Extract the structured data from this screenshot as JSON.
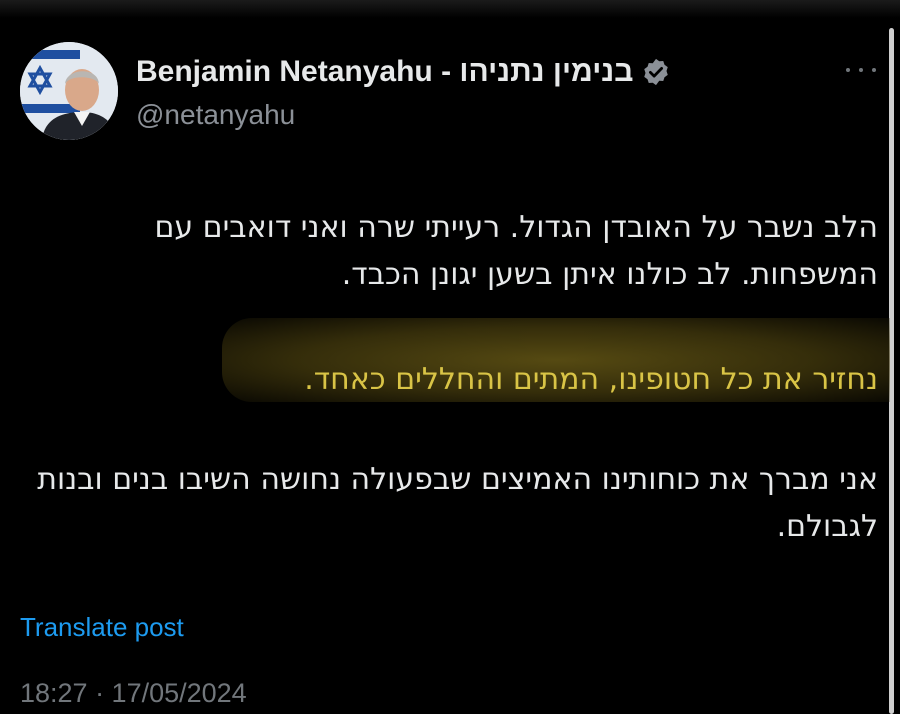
{
  "author": {
    "name": "Benjamin Netanyahu - בנימין נתניהו",
    "handle": "@netanyahu",
    "verified_icon": "verified-badge-icon",
    "verified_color": "#8b9097"
  },
  "post": {
    "paragraph1": "הלב נשבר על האובדן הגדול. רעייתי שרה ואני דואבים עם המשפחות. לב כולנו איתן בשען יגונן הכבד.",
    "paragraph2_highlighted": "נחזיר את כל חטופינו, המתים והחללים כאחד.",
    "paragraph3": "אני מברך את כוחותינו האמיצים שבפעולה נחושה השיבו בנים ובנות לגבולם.",
    "highlight_color": "#d9c446"
  },
  "actions": {
    "translate_label": "Translate post",
    "more_icon": "more-options-icon"
  },
  "meta": {
    "timestamp": "18:27 · 17/05/2024"
  },
  "colors": {
    "background": "#000000",
    "text": "#e7e9ea",
    "muted": "#71767b",
    "link": "#1d9bf0"
  }
}
